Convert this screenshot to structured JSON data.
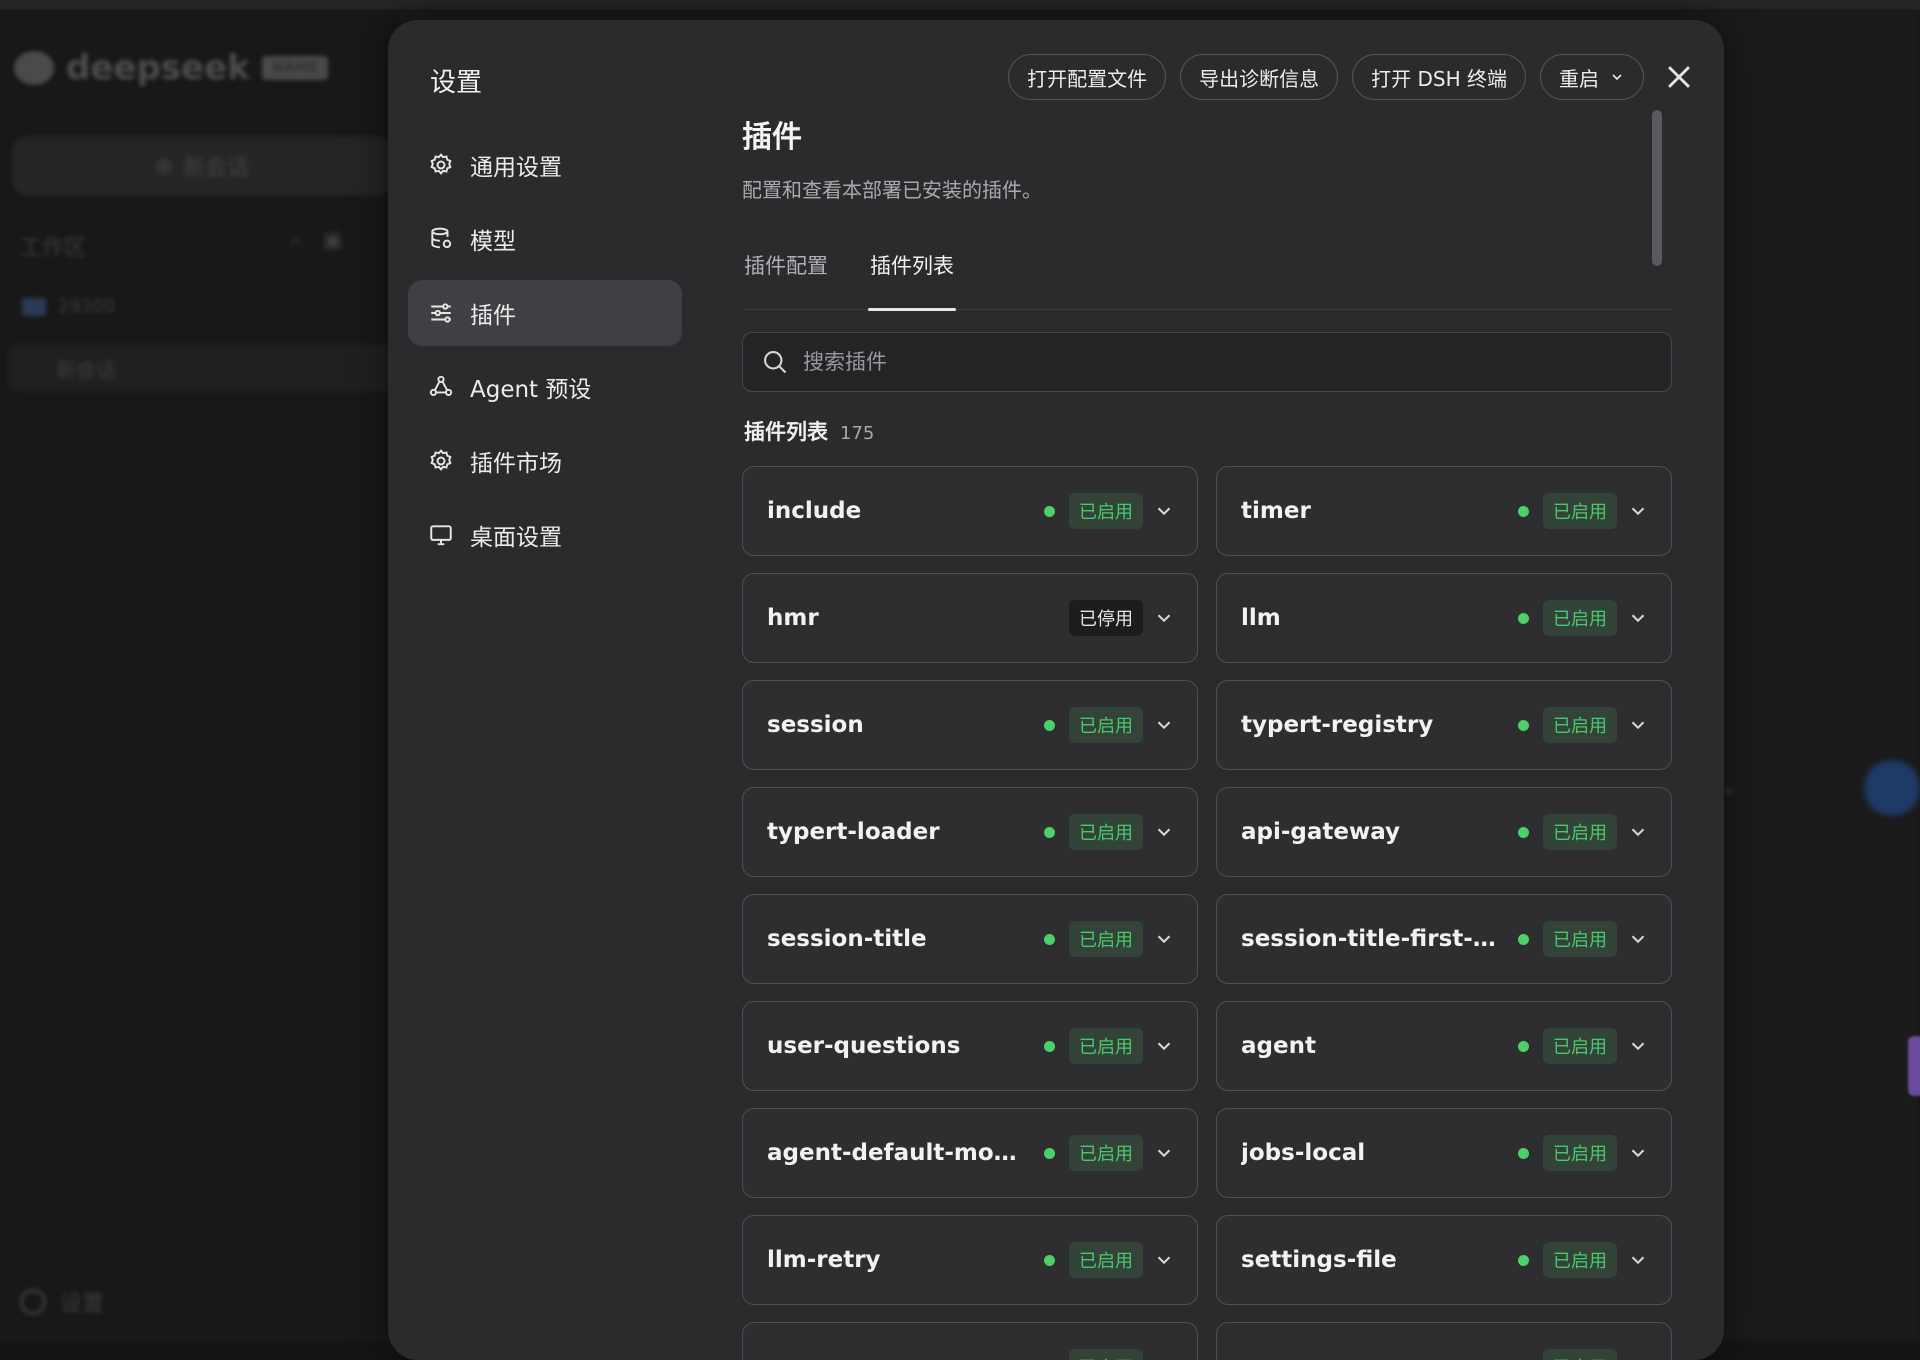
{
  "background": {
    "logo_text": "deepseek",
    "logo_badge": "NAME",
    "new_chat": "新会话",
    "section": "工作区",
    "folder": "29300",
    "chat_item": "新会话",
    "footer": "设置"
  },
  "dialog": {
    "title": "设置",
    "nav": [
      {
        "label": "通用设置",
        "icon": "gear-icon"
      },
      {
        "label": "模型",
        "icon": "database-icon"
      },
      {
        "label": "插件",
        "icon": "sliders-icon"
      },
      {
        "label": "Agent 预设",
        "icon": "agent-icon"
      },
      {
        "label": "插件市场",
        "icon": "gear-icon"
      },
      {
        "label": "桌面设置",
        "icon": "monitor-icon"
      }
    ],
    "toolbar": {
      "open_config": "打开配置文件",
      "export_diag": "导出诊断信息",
      "open_terminal": "打开 DSH 终端",
      "restart": "重启"
    }
  },
  "main": {
    "title": "插件",
    "subtitle": "配置和查看本部署已安装的插件。",
    "tabs": [
      "插件配置",
      "插件列表"
    ],
    "search_placeholder": "搜索插件",
    "list_title": "插件列表",
    "list_count": "175",
    "enabled_label": "已启用",
    "disabled_label": "已停用",
    "plugins": [
      {
        "name": "include",
        "enabled": true
      },
      {
        "name": "timer",
        "enabled": true
      },
      {
        "name": "hmr",
        "enabled": false
      },
      {
        "name": "llm",
        "enabled": true
      },
      {
        "name": "session",
        "enabled": true
      },
      {
        "name": "typert-registry",
        "enabled": true
      },
      {
        "name": "typert-loader",
        "enabled": true
      },
      {
        "name": "api-gateway",
        "enabled": true
      },
      {
        "name": "session-title",
        "enabled": true
      },
      {
        "name": "session-title-first-pro...",
        "enabled": true
      },
      {
        "name": "user-questions",
        "enabled": true
      },
      {
        "name": "agent",
        "enabled": true
      },
      {
        "name": "agent-default-model",
        "enabled": true
      },
      {
        "name": "jobs-local",
        "enabled": true
      },
      {
        "name": "llm-retry",
        "enabled": true
      },
      {
        "name": "settings-file",
        "enabled": true
      },
      {
        "name": "",
        "enabled": true
      },
      {
        "name": "",
        "enabled": true
      }
    ]
  },
  "colors": {
    "accent_enabled": "#4bd06a",
    "dialog_bg": "#2b2b2d",
    "nav_active": "#404044"
  }
}
